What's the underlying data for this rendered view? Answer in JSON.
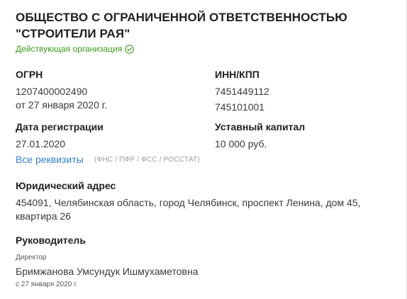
{
  "company": {
    "name": "ОБЩЕСТВО С ОГРАНИЧЕННОЙ ОТВЕТСТВЕННОСТЬЮ \"СТРОИТЕЛИ РАЯ\"",
    "status": "Действующая организация",
    "status_icon": "check-circle-icon",
    "status_color": "#3a9a1d"
  },
  "ogrn": {
    "label": "ОГРН",
    "value": "1207400002490",
    "date": "от 27 января 2020 г."
  },
  "inn_kpp": {
    "label": "ИНН/КПП",
    "inn": "7451449112",
    "kpp": "745101001"
  },
  "registration": {
    "label": "Дата регистрации",
    "value": "27.01.2020"
  },
  "capital": {
    "label": "Уставный капитал",
    "value": "10 000 руб."
  },
  "requisites": {
    "link_label": "Все реквизиты",
    "sources": "(ФНС / ПФР / ФСС / РОССТАТ)",
    "link_color": "#2f7fce"
  },
  "address": {
    "label": "Юридический адрес",
    "line1": "454091, Челябинская область, город Челябинск, проспект Ленина, дом 45,",
    "line2": "квартира 26"
  },
  "head": {
    "label": "Руководитель",
    "position": "Директор",
    "name": "Бримжанова Умсундук Ишмухаметовна",
    "since": "с 27 января 2020 г."
  }
}
